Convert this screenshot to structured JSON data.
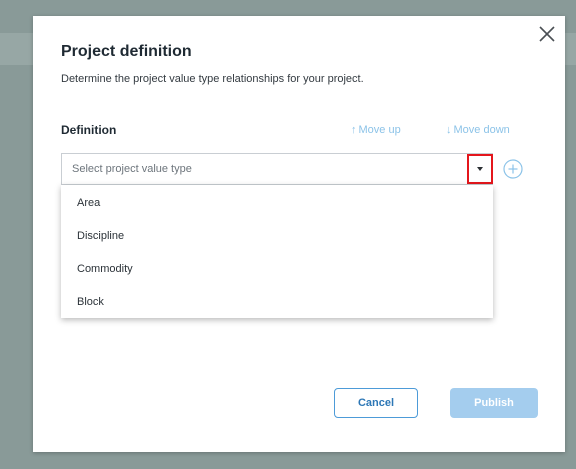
{
  "dialog": {
    "title": "Project definition",
    "description": "Determine the project value type relationships for your project."
  },
  "definition": {
    "label": "Definition",
    "move_up_label": "Move up",
    "move_down_label": "Move down",
    "move_up_arrow": "↑",
    "move_down_arrow": "↓"
  },
  "select": {
    "placeholder": "Select project value type",
    "options": [
      "Area",
      "Discipline",
      "Commodity",
      "Block"
    ]
  },
  "footer": {
    "cancel_label": "Cancel",
    "publish_label": "Publish"
  },
  "colors": {
    "accent": "#2d77b6",
    "highlight": "#e4161c",
    "disabled_primary": "#a4cdee",
    "link_disabled": "#8cc3e8"
  },
  "icons": {
    "close": "close-icon",
    "dropdown": "caret-down-icon",
    "add": "plus-circle-icon"
  }
}
